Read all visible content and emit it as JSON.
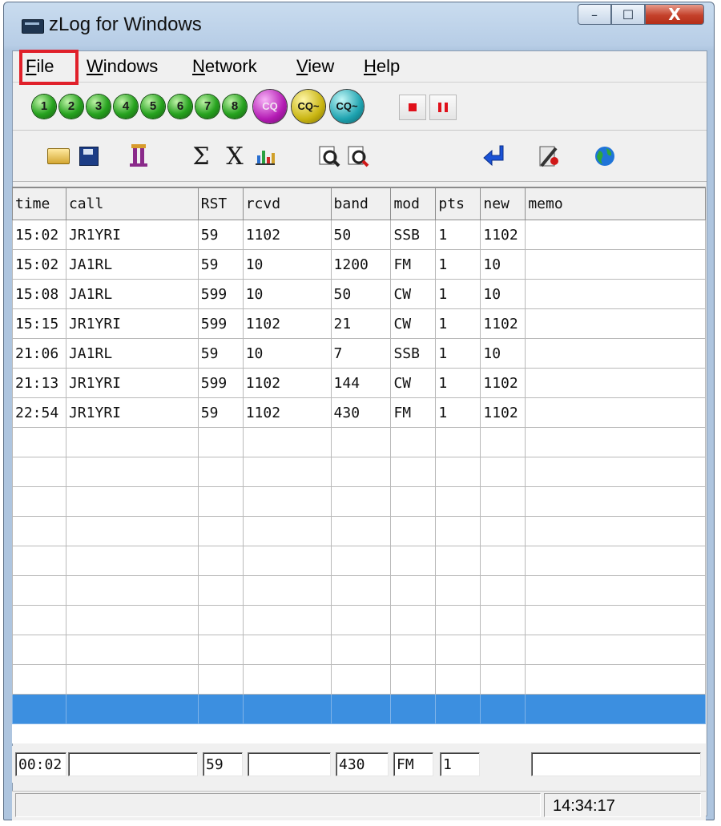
{
  "window": {
    "title": "zLog for Windows",
    "minimize": "–",
    "maximize": "☐",
    "close": "X"
  },
  "menu": {
    "items": [
      {
        "label": "File",
        "mnemonic": "F"
      },
      {
        "label": "Windows",
        "mnemonic": "W"
      },
      {
        "label": "Network",
        "mnemonic": "N"
      },
      {
        "label": "View",
        "mnemonic": "V"
      },
      {
        "label": "Help",
        "mnemonic": "H"
      }
    ]
  },
  "cw_toolbar": {
    "memories": [
      "1",
      "2",
      "3",
      "4",
      "5",
      "6",
      "7",
      "8"
    ],
    "cq_buttons": [
      "CQ",
      "CQ~",
      "CQ~"
    ]
  },
  "main_toolbar": {
    "icons": [
      "open-folder-icon",
      "save-icon",
      "partial-check-icon",
      "sigma-icon",
      "x-icon",
      "bar-chart-icon",
      "find-icon",
      "find-red-icon",
      "enter-arrow-icon",
      "tools-icon",
      "globe-icon"
    ],
    "sigma": "Σ",
    "x": "X"
  },
  "log": {
    "columns": [
      "time",
      "call",
      "RST",
      "rcvd",
      "band",
      "mod",
      "pts",
      "new",
      "memo"
    ],
    "rows": [
      [
        "15:02",
        "JR1YRI",
        "59",
        "1102",
        "50",
        "SSB",
        "1",
        "1102",
        ""
      ],
      [
        "15:02",
        "JA1RL",
        "59",
        "10",
        "1200",
        "FM",
        "1",
        "10",
        ""
      ],
      [
        "15:08",
        "JA1RL",
        "599",
        "10",
        "50",
        "CW",
        "1",
        "10",
        ""
      ],
      [
        "15:15",
        "JR1YRI",
        "599",
        "1102",
        "21",
        "CW",
        "1",
        "1102",
        ""
      ],
      [
        "21:06",
        "JA1RL",
        "59",
        "10",
        "7",
        "SSB",
        "1",
        "10",
        ""
      ],
      [
        "21:13",
        "JR1YRI",
        "599",
        "1102",
        "144",
        "CW",
        "1",
        "1102",
        ""
      ],
      [
        "22:54",
        "JR1YRI",
        "59",
        "1102",
        "430",
        "FM",
        "1",
        "1102",
        ""
      ]
    ],
    "empty_rows": 9,
    "selected_color": "#3c8fe0"
  },
  "entry": {
    "time": "00:02",
    "call": "",
    "rst": "59",
    "rcvd": "",
    "band": "430",
    "mode": "FM",
    "pts": "1",
    "memo": ""
  },
  "status": {
    "message": "",
    "clock": "14:34:17"
  },
  "colors": {
    "highlight": "#e0202a",
    "selection": "#3c8fe0",
    "memory": "#27a31f"
  }
}
